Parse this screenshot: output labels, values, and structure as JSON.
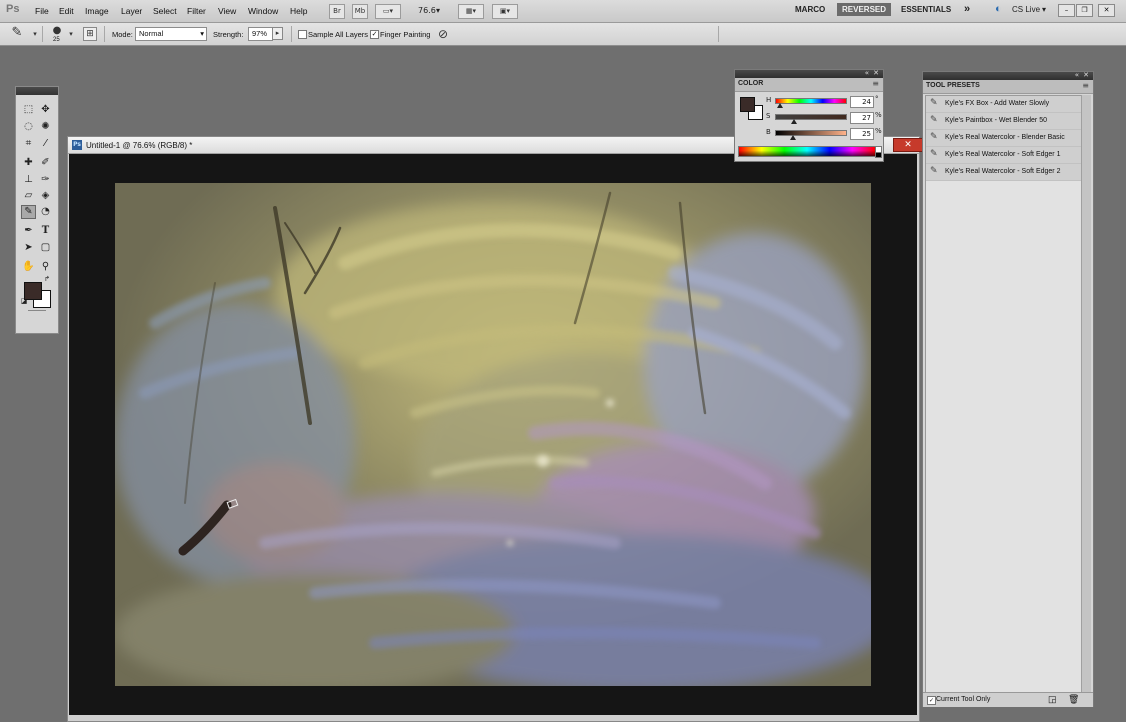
{
  "app": {
    "logo": "Ps"
  },
  "menu": [
    "File",
    "Edit",
    "Image",
    "Layer",
    "Select",
    "Filter",
    "View",
    "Window",
    "Help"
  ],
  "menubar": {
    "btn_br": "Br",
    "btn_mb": "Mb",
    "zoom": "76.6",
    "workspaces": [
      "MARCO",
      "REVERSED",
      "ESSENTIALS"
    ],
    "active_workspace": "REVERSED",
    "more": "»",
    "cs_live": "CS Live"
  },
  "options": {
    "brush_size": "25",
    "mode_label": "Mode:",
    "mode_value": "Normal",
    "strength_label": "Strength:",
    "strength_value": "97%",
    "sample_all_layers": "Sample All Layers",
    "sample_all_layers_checked": false,
    "finger_painting": "Finger Painting",
    "finger_painting_checked": true
  },
  "document": {
    "title": "Untitled-1 @ 76.6% (RGB/8) *",
    "icon": "Ps"
  },
  "color_panel": {
    "tab": "COLOR",
    "foreground_color": "#3a2b28",
    "background_color": "#ffffff",
    "sliders": [
      {
        "label": "H",
        "value": "24",
        "unit": "°",
        "position": 0.07
      },
      {
        "label": "S",
        "value": "27",
        "unit": "%",
        "position": 0.27
      },
      {
        "label": "B",
        "value": "25",
        "unit": "%",
        "position": 0.25
      }
    ]
  },
  "tool_presets": {
    "title": "TOOL PRESETS",
    "items": [
      "Kyle's FX Box - Add Water Slowly",
      "Kyle's Paintbox - Wet Blender 50",
      "Kyle's Real Watercolor - Blender Basic",
      "Kyle's Real Watercolor - Soft Edger 1",
      "Kyle's Real Watercolor - Soft Edger 2"
    ],
    "current_tool_only": "Current Tool Only",
    "current_tool_only_checked": true
  },
  "colors": {
    "accent_active_workspace": "#6b6b6b",
    "close_button": "#c63a2b",
    "canvas_base": "#7d7a5e"
  }
}
